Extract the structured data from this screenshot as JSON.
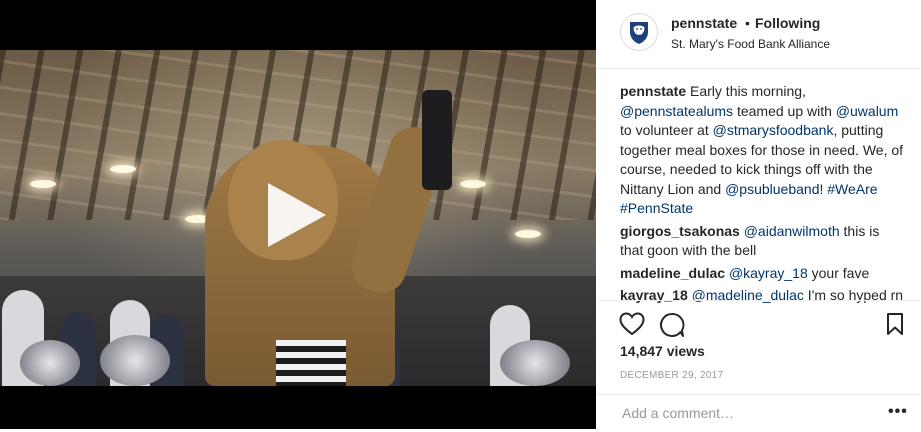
{
  "media": {
    "play_icon": "play-icon"
  },
  "header": {
    "username": "pennstate",
    "separator": "•",
    "follow_status": "Following",
    "location": "St. Mary's Food Bank Alliance",
    "avatar_icon": "penn-state-lion-shield-icon",
    "brand_color": "#1e407c"
  },
  "caption": {
    "username": "pennstate",
    "parts": [
      {
        "text": "Early this morning, ",
        "link": false
      },
      {
        "text": "@pennstatealums",
        "link": true
      },
      {
        "text": " teamed up with ",
        "link": false
      },
      {
        "text": "@uwalum",
        "link": true
      },
      {
        "text": " to volunteer at ",
        "link": false
      },
      {
        "text": "@stmarysfoodbank",
        "link": true
      },
      {
        "text": ", putting together meal boxes for those in need. We, of course, needed to kick things off with the Nittany Lion and ",
        "link": false
      },
      {
        "text": "@psublueband",
        "link": true
      },
      {
        "text": "! ",
        "link": false
      },
      {
        "text": "#WeAre",
        "link": true
      },
      {
        "text": " ",
        "link": false
      },
      {
        "text": "#PennState",
        "link": true
      }
    ]
  },
  "comments": [
    {
      "username": "giorgos_tsakonas",
      "mention": "@aidanwilmoth",
      "text": " this is that goon with the bell"
    },
    {
      "username": "madeline_dulac",
      "mention": "@kayray_18",
      "text": " your fave"
    },
    {
      "username": "kayray_18",
      "mention": "@madeline_dulac",
      "text": " I'm so hyped rn"
    }
  ],
  "actions": {
    "like_icon": "heart-icon",
    "comment_icon": "comment-icon",
    "save_icon": "bookmark-icon",
    "views": "14,847 views",
    "date": "DECEMBER 29, 2017"
  },
  "add_comment": {
    "placeholder": "Add a comment…",
    "more_label": "•••"
  },
  "colors": {
    "link": "#003569",
    "text": "#262626",
    "muted": "#999999",
    "border": "#efefef"
  }
}
